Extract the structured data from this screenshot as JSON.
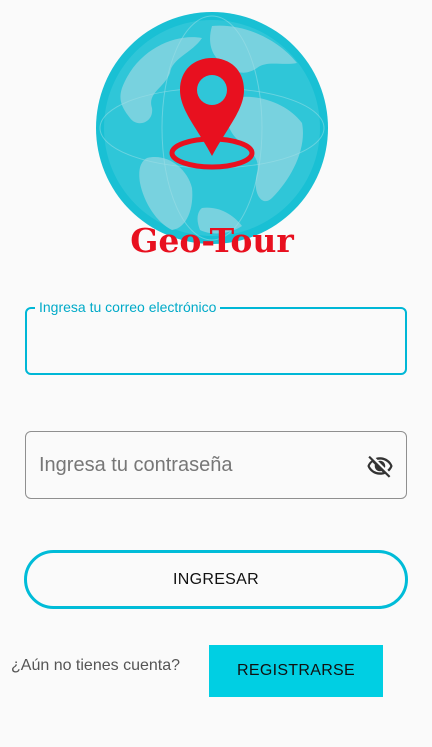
{
  "logo": {
    "brand_text": "Geo-Tour",
    "globe_color": "#5bc7d6",
    "ocean_color": "#1ec3d6",
    "land_color": "#6dd0de",
    "pin_color": "#e8101f"
  },
  "login_form": {
    "email_label": "Ingresa tu correo electrónico",
    "email_value": "",
    "password_placeholder": "Ingresa tu contraseña",
    "password_visibility_icon": "eye-off-icon",
    "submit_label": "INGRESAR"
  },
  "register": {
    "prompt": "¿Aún no tienes cuenta?",
    "button_label": "REGISTRARSE"
  },
  "colors": {
    "accent": "#00bcd8",
    "register_button": "#00cfe3",
    "background": "#fafafa"
  }
}
